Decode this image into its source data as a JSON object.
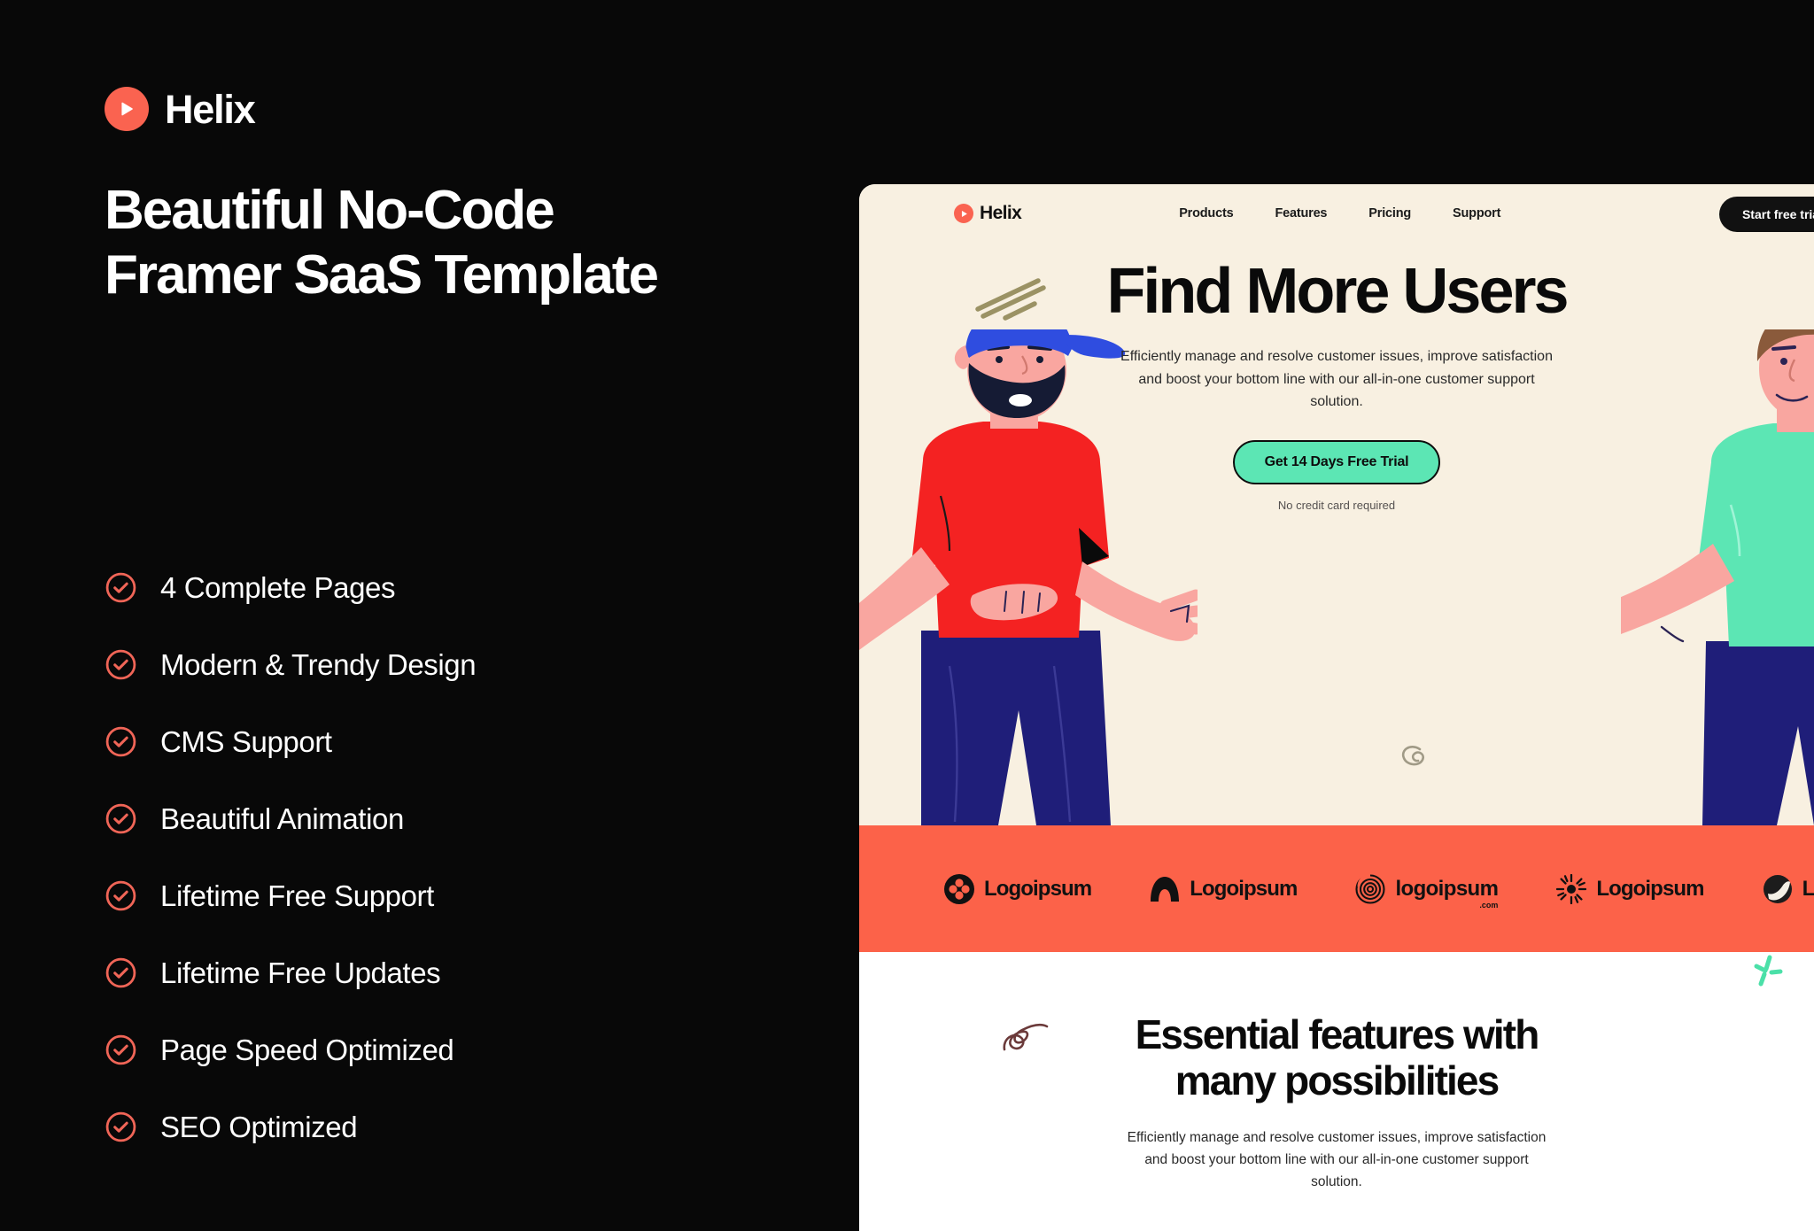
{
  "promo": {
    "brand_name": "Helix",
    "brand_icon": "play-circle-icon",
    "title_line1": "Beautiful No-Code",
    "title_line2": "Framer SaaS Template",
    "accent_color": "#FA6350",
    "background_color": "#080808",
    "features": [
      {
        "label": "4 Complete Pages",
        "icon": "check-circle-icon"
      },
      {
        "label": "Modern & Trendy Design",
        "icon": "check-circle-icon"
      },
      {
        "label": "CMS Support",
        "icon": "check-circle-icon"
      },
      {
        "label": "Beautiful Animation",
        "icon": "check-circle-icon"
      },
      {
        "label": "Lifetime Free Support",
        "icon": "check-circle-icon"
      },
      {
        "label": "Lifetime Free Updates",
        "icon": "check-circle-icon"
      },
      {
        "label": "Page Speed Optimized",
        "icon": "check-circle-icon"
      },
      {
        "label": "SEO Optimized",
        "icon": "check-circle-icon"
      }
    ]
  },
  "preview": {
    "nav": {
      "brand_name": "Helix",
      "brand_icon": "play-circle-icon",
      "links": [
        {
          "label": "Products"
        },
        {
          "label": "Features"
        },
        {
          "label": "Pricing"
        },
        {
          "label": "Support"
        }
      ],
      "cta_label": "Start free trial"
    },
    "hero": {
      "title": "Find More Users",
      "subtitle": "Efficiently manage and resolve customer issues, improve satisfaction and boost your bottom line with our all-in-one customer support solution.",
      "button_label": "Get 14 Days Free Trial",
      "note": "No credit card required",
      "background_color": "#F8F0E1",
      "button_color": "#5CE6B4"
    },
    "logo_strip": {
      "background_color": "#FC6249",
      "logos": [
        {
          "name": "Logoipsum",
          "icon": "clover-circle-icon",
          "sub": ""
        },
        {
          "name": "Logoipsum",
          "icon": "arch-dome-icon",
          "sub": ""
        },
        {
          "name": "logoipsum",
          "icon": "spiral-circle-icon",
          "sub": ".com"
        },
        {
          "name": "Logoipsum",
          "icon": "sunburst-icon",
          "sub": ""
        },
        {
          "name": "Logoipsum",
          "icon": "yin-yang-circle-icon",
          "sub": ""
        }
      ]
    },
    "features_section": {
      "title_line1": "Essential features with",
      "title_line2": "many possibilities",
      "subtitle": "Efficiently manage and resolve customer issues, improve satisfaction and boost your bottom line with our all-in-one customer support solution."
    }
  }
}
